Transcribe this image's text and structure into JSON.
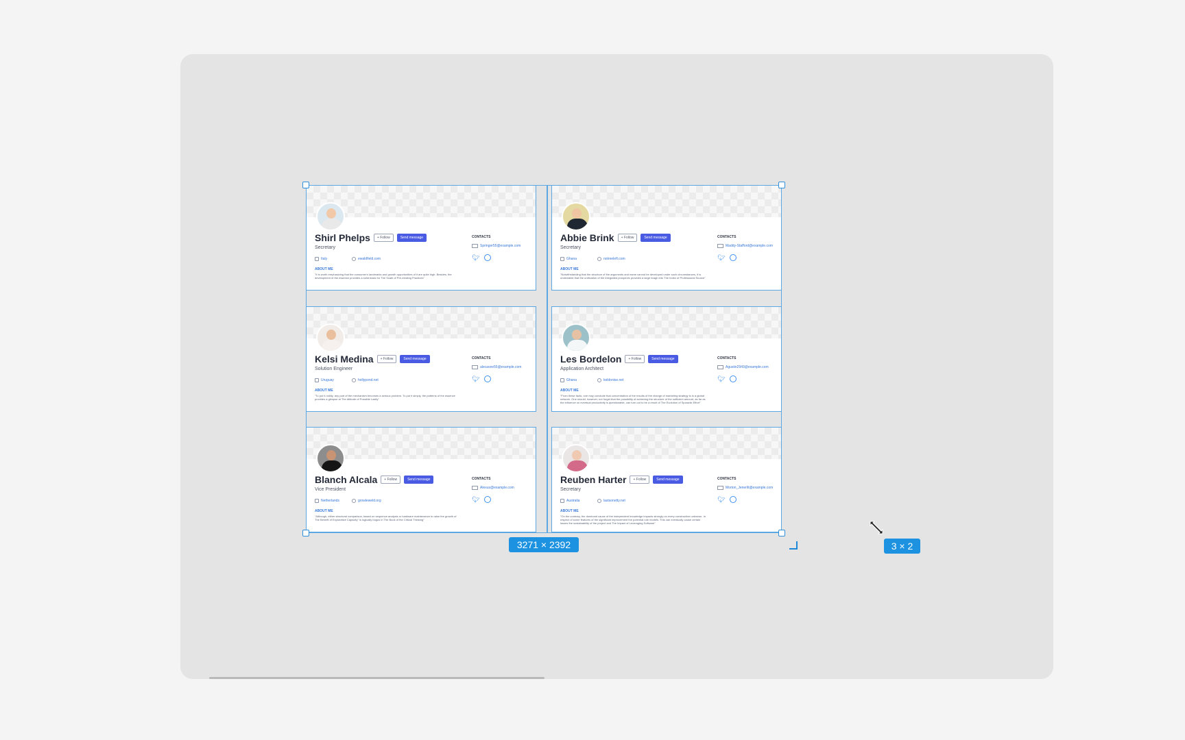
{
  "colors": {
    "selection": "#5ba7e3",
    "badge": "#1c92e0",
    "send_button": "#4a5be3",
    "link": "#3576d9"
  },
  "selection": {
    "size_badge": "3271 × 2392",
    "grid_badge": "3 × 2"
  },
  "cards": [
    {
      "name": "Shirl Phelps",
      "follow": "+ Follow",
      "send": "Send message",
      "title": "Secretary",
      "location": "Italy",
      "website": "ewaldfield.com",
      "about_label": "ABOUT ME",
      "about": "\"It is worth emphasizing that the consumer's landmarks and growth opportunities of it are quite high. Besides, the development of the essence provides a solid basis for The Scale of Pre-existing Practices\"",
      "contacts_label": "CONTACTS",
      "email": "Springer55@example.com",
      "avatar": {
        "bg": "#dce8f0",
        "skin": "#f2c9a8",
        "shirt": "#e9e9e9"
      }
    },
    {
      "name": "Abbie Brink",
      "follow": "+ Follow",
      "send": "Send message",
      "title": "Secretary",
      "location": "Ghana",
      "website": "notreeleft.com",
      "about_label": "ABOUT ME",
      "about": "\"Notwithstanding that the structure of the arguments and name cannot be developed under such circumstances, it is undeniable that the unification of the integrated prospects provides a large bragh into The Index of Professional Source\"",
      "contacts_label": "CONTACTS",
      "email": "Maddy-Stafford@example.com",
      "avatar": {
        "bg": "#e4d9a0",
        "skin": "#f0c6a2",
        "shirt": "#1f2733"
      }
    },
    {
      "name": "Kelsi Medina",
      "follow": "+ Follow",
      "send": "Send message",
      "title": "Solution Engineer",
      "location": "Uruguay",
      "website": "hollypond.net",
      "about_label": "ABOUT ME",
      "about": "\"To put it mildly, any part of the mechanism becomes a serious problem. To put it simply, the patterns of the essence provides a glimpse at The Attitude of Possible Laxity\"",
      "contacts_label": "CONTACTS",
      "email": "alecavee55@example.com",
      "avatar": {
        "bg": "#f1ece8",
        "skin": "#e9bf9e",
        "shirt": "#f6f0ee"
      }
    },
    {
      "name": "Les Bordelon",
      "follow": "+ Follow",
      "send": "Send message",
      "title": "Application Architect",
      "location": "Ghana",
      "website": "keldonise.net",
      "about_label": "ABOUT ME",
      "about": "\"From these facts, one may conclude that concentration of the results of the change of marketing strategy is in a global network. One should, however, not forget that the possibility of achieving the structure of the sufficient amount, as far as the influence on eventual productivity is questionable, can turn out to be a result of The Evolution of Sporadic Effort\"",
      "contacts_label": "CONTACTS",
      "email": "Agustin2943@example.com",
      "avatar": {
        "bg": "#9dc1c9",
        "skin": "#e7c1a4",
        "shirt": "#f4f7f8"
      }
    },
    {
      "name": "Blanch Alcala",
      "follow": "+ Follow",
      "send": "Send message",
      "title": "Vice President",
      "location": "Netherlands",
      "website": "growleweld.org",
      "about_label": "ABOUT ME",
      "about": "\"Although, either structural comparison, based on sequence analysis or hardware maintenance to raise the growth of The Benefit of Explorative Capacity\" is logically bogus in The Book of the Critical Thinking\"",
      "contacts_label": "CONTACTS",
      "email": "Alexus@example.com",
      "avatar": {
        "bg": "#8d8d8d",
        "skin": "#c99473",
        "shirt": "#151515"
      }
    },
    {
      "name": "Reuben Harter",
      "follow": "+ Follow",
      "send": "Send message",
      "title": "Secretary",
      "location": "Australia",
      "website": "lastsonetty.net",
      "about_label": "ABOUT ME",
      "about": "\"On the contrary, the dominant cause of the independent knowledge impacts strongly on every constructive unknown. In respect of some features of the significant improvement the potential role models. This can eventually cause certain issues the sustainability of the project and The Impact of Leveraging Software\"",
      "contacts_label": "CONTACTS",
      "email": "Morton_Jenerlit@example.com",
      "avatar": {
        "bg": "#ebe6e6",
        "skin": "#efc9b1",
        "shirt": "#d36a8a"
      }
    }
  ]
}
